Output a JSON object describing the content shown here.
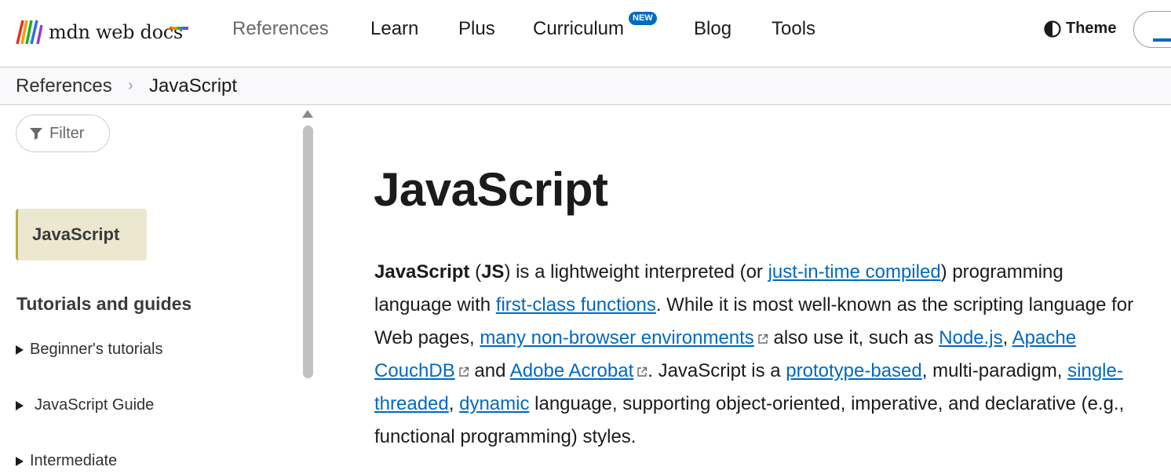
{
  "header": {
    "logo_text": "mdn web docs",
    "nav": [
      {
        "label": "References",
        "active": true
      },
      {
        "label": "Learn"
      },
      {
        "label": "Plus"
      },
      {
        "label": "Curriculum",
        "badge": "NEW"
      },
      {
        "label": "Blog"
      },
      {
        "label": "Tools"
      }
    ],
    "theme_label": "Theme",
    "theme_icon": "half-circle-contrast-icon",
    "accent_color": "#0069c2"
  },
  "breadcrumb": {
    "items": [
      "References",
      "JavaScript"
    ],
    "separator": "›"
  },
  "sidebar": {
    "filter_placeholder": "Filter",
    "current": "JavaScript",
    "section_heading": "Tutorials and guides",
    "items": [
      {
        "label": "Beginner's tutorials",
        "collapsed": true
      },
      {
        "label": "JavaScript Guide",
        "collapsed": true
      },
      {
        "label": "Intermediate",
        "collapsed": true
      }
    ]
  },
  "main": {
    "title": "JavaScript",
    "intro": {
      "s1": "JavaScript",
      "s2": " (",
      "s3": "JS",
      "s4": ") is a lightweight interpreted (or ",
      "link1": "just-in-time compiled",
      "s5": ") programming language with ",
      "link2": "first-class functions",
      "s6": ". While it is most well-known as the scripting language for Web pages, ",
      "link3": "many non-browser environments",
      "s7": " also use it, such as ",
      "link4": "Node.js",
      "s8": ", ",
      "link5": "Apache CouchDB",
      "s9": " and ",
      "link6": "Adobe Acrobat",
      "s10": ". JavaScript is a ",
      "link7": "prototype-based",
      "s11": ", multi-paradigm, ",
      "link8": "single-threaded",
      "s12": ", ",
      "link9": "dynamic",
      "s13": " language, supporting object-oriented, imperative, and declarative (e.g., functional programming) styles."
    }
  }
}
